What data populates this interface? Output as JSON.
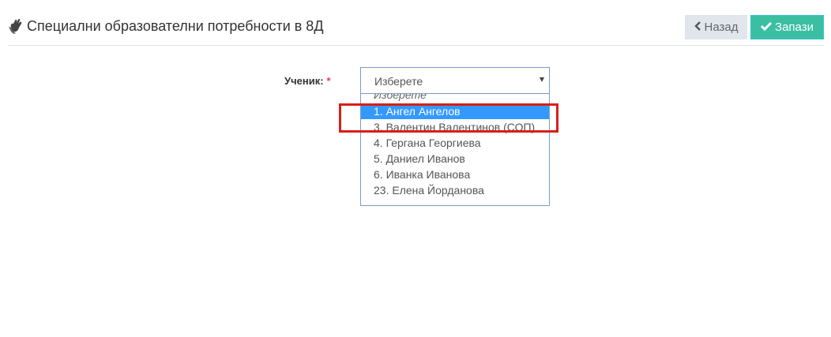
{
  "header": {
    "icon": "hands-icon",
    "title": "Специални образователни потребности в 8Д",
    "back_label": "Назад",
    "back_icon": "chevron-left-icon",
    "save_label": "Запази",
    "save_icon": "check-icon"
  },
  "form": {
    "student_label": "Ученик:",
    "required_mark": "*",
    "select_value": "Изберете",
    "options": [
      {
        "label": "Изберете",
        "state": "placeholder"
      },
      {
        "label": "1. Ангел Ангелов",
        "state": "selected"
      },
      {
        "label": "3. Валентин Валентинов (СОП)",
        "state": "normal"
      },
      {
        "label": "4. Гергана Георгиева",
        "state": "normal"
      },
      {
        "label": "5. Даниел Иванов",
        "state": "normal"
      },
      {
        "label": "6. Иванка Иванова",
        "state": "normal"
      },
      {
        "label": "23. Елена Йорданова",
        "state": "normal"
      }
    ]
  },
  "colors": {
    "accent": "#3399ff",
    "save_button": "#3bbfa3",
    "back_button": "#e1e5ec",
    "required": "#e73d4a",
    "highlight": "#d91e18"
  }
}
